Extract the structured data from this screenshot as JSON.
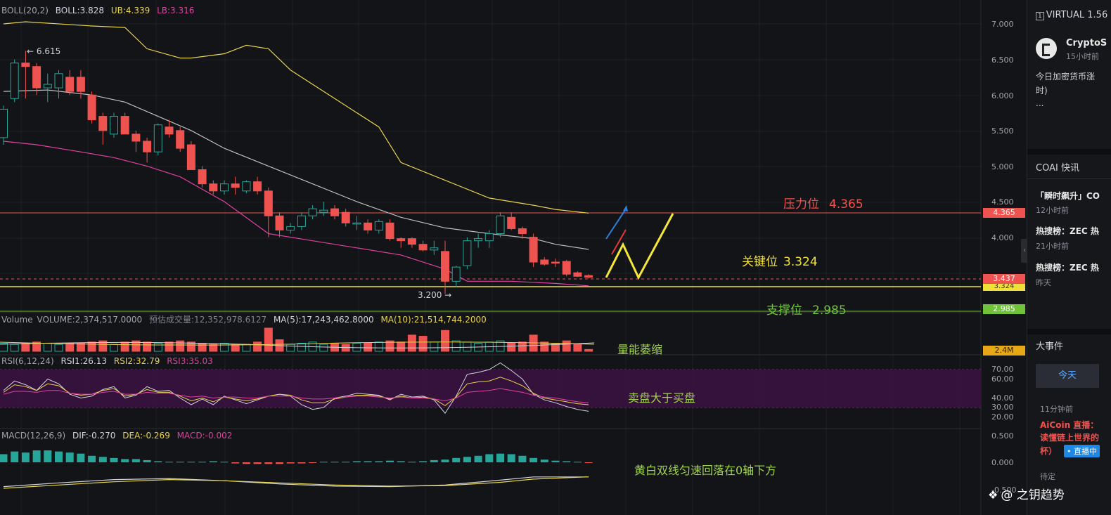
{
  "indicators": {
    "boll": {
      "name": "BOLL(20,2)",
      "value": "BOLL:3.828",
      "ub": "UB:4.339",
      "lb": "LB:3.316"
    },
    "volume": {
      "name": "Volume",
      "value": "VOLUME:2,374,517.0000",
      "estimate": "预估成交量:12,352,978.6127",
      "ma5": "MA(5):17,243,462.8000",
      "ma10": "MA(10):21,514,744.2000"
    },
    "rsi": {
      "name": "RSI(6,12,24)",
      "rsi1": "RSI1:26.13",
      "rsi2": "RSI2:32.79",
      "rsi3": "RSI3:35.03"
    },
    "macd": {
      "name": "MACD(12,26,9)",
      "dif": "DIF:-0.270",
      "dea": "DEA:-0.269",
      "macd": "MACD:-0.002"
    }
  },
  "price_axis": [
    "7.000",
    "6.500",
    "6.000",
    "5.500",
    "5.000",
    "4.500",
    "4.000"
  ],
  "rsi_axis": [
    "70.00",
    "60.00",
    "40.00",
    "30.00",
    "20.00"
  ],
  "macd_axis": [
    "0.500",
    "0.000",
    "-0.500"
  ],
  "price_tags": {
    "resistance": "4.365",
    "current": "3.437",
    "key": "3.324",
    "support": "2.985",
    "volume": "2.4M"
  },
  "chart_labels": {
    "high": "← 6.615",
    "low": "3.200 →"
  },
  "annotations": {
    "resistance_label": "压力位",
    "resistance_value": "4.365",
    "key_label": "关键位",
    "key_value": "3.324",
    "support_label": "支撑位",
    "support_value": "2.985",
    "volume_note": "量能萎缩",
    "rsi_note": "卖盘大于买盘",
    "macd_note": "黄白双线匀速回落在0轴下方"
  },
  "colors": {
    "up": "#26a69a",
    "down": "#ef5350",
    "upper_band": "#e8d44d",
    "lower_band": "#e040a0",
    "mid_band": "#bfbfbf",
    "resistance": "#ef5350",
    "key": "#f0e03a",
    "support": "#6fc23a"
  },
  "chart_data": {
    "type": "candlestick",
    "ylim": [
      2.9,
      7.1
    ],
    "candles": [
      {
        "o": 5.4,
        "h": 5.85,
        "l": 5.3,
        "c": 5.8
      },
      {
        "o": 5.95,
        "h": 6.5,
        "l": 5.9,
        "c": 6.45
      },
      {
        "o": 6.45,
        "h": 6.62,
        "l": 5.95,
        "c": 6.4
      },
      {
        "o": 6.4,
        "h": 6.45,
        "l": 6.0,
        "c": 6.1
      },
      {
        "o": 6.1,
        "h": 6.3,
        "l": 5.9,
        "c": 6.15
      },
      {
        "o": 6.1,
        "h": 6.35,
        "l": 5.95,
        "c": 6.3
      },
      {
        "o": 6.25,
        "h": 6.35,
        "l": 6.0,
        "c": 6.05
      },
      {
        "o": 6.25,
        "h": 6.35,
        "l": 5.95,
        "c": 6.05
      },
      {
        "o": 6.0,
        "h": 6.05,
        "l": 5.6,
        "c": 5.65
      },
      {
        "o": 5.7,
        "h": 5.75,
        "l": 5.3,
        "c": 5.5
      },
      {
        "o": 5.45,
        "h": 5.75,
        "l": 5.4,
        "c": 5.7
      },
      {
        "o": 5.7,
        "h": 5.75,
        "l": 5.45,
        "c": 5.45
      },
      {
        "o": 5.45,
        "h": 5.5,
        "l": 5.2,
        "c": 5.35
      },
      {
        "o": 5.35,
        "h": 5.4,
        "l": 5.05,
        "c": 5.2
      },
      {
        "o": 5.2,
        "h": 5.6,
        "l": 5.15,
        "c": 5.58
      },
      {
        "o": 5.55,
        "h": 5.65,
        "l": 5.4,
        "c": 5.45
      },
      {
        "o": 5.5,
        "h": 5.55,
        "l": 5.2,
        "c": 5.25
      },
      {
        "o": 5.3,
        "h": 5.35,
        "l": 4.95,
        "c": 4.95
      },
      {
        "o": 4.95,
        "h": 5.0,
        "l": 4.7,
        "c": 4.75
      },
      {
        "o": 4.75,
        "h": 4.8,
        "l": 4.6,
        "c": 4.65
      },
      {
        "o": 4.65,
        "h": 4.8,
        "l": 4.6,
        "c": 4.75
      },
      {
        "o": 4.75,
        "h": 4.85,
        "l": 4.6,
        "c": 4.7
      },
      {
        "o": 4.65,
        "h": 4.8,
        "l": 4.62,
        "c": 4.78
      },
      {
        "o": 4.78,
        "h": 4.85,
        "l": 4.6,
        "c": 4.65
      },
      {
        "o": 4.65,
        "h": 4.7,
        "l": 4.0,
        "c": 4.3
      },
      {
        "o": 4.3,
        "h": 4.35,
        "l": 4.0,
        "c": 4.1
      },
      {
        "o": 4.1,
        "h": 4.2,
        "l": 4.05,
        "c": 4.15
      },
      {
        "o": 4.15,
        "h": 4.35,
        "l": 4.1,
        "c": 4.3
      },
      {
        "o": 4.3,
        "h": 4.45,
        "l": 4.25,
        "c": 4.4
      },
      {
        "o": 4.35,
        "h": 4.5,
        "l": 4.3,
        "c": 4.38
      },
      {
        "o": 4.4,
        "h": 4.45,
        "l": 4.25,
        "c": 4.3
      },
      {
        "o": 4.35,
        "h": 4.4,
        "l": 4.15,
        "c": 4.2
      },
      {
        "o": 4.2,
        "h": 4.3,
        "l": 4.1,
        "c": 4.2
      },
      {
        "o": 4.2,
        "h": 4.25,
        "l": 4.05,
        "c": 4.1
      },
      {
        "o": 4.1,
        "h": 4.25,
        "l": 4.05,
        "c": 4.22
      },
      {
        "o": 4.2,
        "h": 4.25,
        "l": 3.95,
        "c": 3.98
      },
      {
        "o": 3.98,
        "h": 4.0,
        "l": 3.85,
        "c": 3.95
      },
      {
        "o": 3.98,
        "h": 4.0,
        "l": 3.85,
        "c": 3.9
      },
      {
        "o": 3.9,
        "h": 3.95,
        "l": 3.8,
        "c": 3.82
      },
      {
        "o": 3.82,
        "h": 3.95,
        "l": 3.75,
        "c": 3.85
      },
      {
        "o": 3.8,
        "h": 3.95,
        "l": 3.2,
        "c": 3.38
      },
      {
        "o": 3.38,
        "h": 3.6,
        "l": 3.3,
        "c": 3.58
      },
      {
        "o": 3.6,
        "h": 4.0,
        "l": 3.55,
        "c": 3.95
      },
      {
        "o": 3.95,
        "h": 4.05,
        "l": 3.85,
        "c": 3.98
      },
      {
        "o": 3.95,
        "h": 4.1,
        "l": 3.85,
        "c": 4.05
      },
      {
        "o": 4.05,
        "h": 4.35,
        "l": 4.0,
        "c": 4.3
      },
      {
        "o": 4.28,
        "h": 4.35,
        "l": 4.1,
        "c": 4.12
      },
      {
        "o": 4.12,
        "h": 4.15,
        "l": 3.98,
        "c": 4.05
      },
      {
        "o": 4.0,
        "h": 4.05,
        "l": 3.58,
        "c": 3.65
      },
      {
        "o": 3.68,
        "h": 3.72,
        "l": 3.6,
        "c": 3.62
      },
      {
        "o": 3.65,
        "h": 3.7,
        "l": 3.58,
        "c": 3.64
      },
      {
        "o": 3.66,
        "h": 3.68,
        "l": 3.45,
        "c": 3.48
      },
      {
        "o": 3.5,
        "h": 3.52,
        "l": 3.44,
        "c": 3.45
      },
      {
        "o": 3.46,
        "h": 3.48,
        "l": 3.42,
        "c": 3.437
      }
    ],
    "boll_upper": [
      [
        0,
        7.0
      ],
      [
        2,
        7.03
      ],
      [
        8,
        6.97
      ],
      [
        11,
        6.95
      ],
      [
        13,
        6.65
      ],
      [
        16,
        6.52
      ],
      [
        17,
        6.52
      ],
      [
        20,
        6.58
      ],
      [
        22,
        6.7
      ],
      [
        24,
        6.65
      ],
      [
        26,
        6.35
      ],
      [
        30,
        5.95
      ],
      [
        34,
        5.55
      ],
      [
        36,
        5.05
      ],
      [
        40,
        4.8
      ],
      [
        44,
        4.55
      ],
      [
        48,
        4.45
      ],
      [
        50,
        4.39
      ],
      [
        53,
        4.339
      ]
    ],
    "boll_mid": [
      [
        0,
        6.05
      ],
      [
        4,
        6.07
      ],
      [
        8,
        6.0
      ],
      [
        11,
        5.9
      ],
      [
        14,
        5.7
      ],
      [
        17,
        5.5
      ],
      [
        20,
        5.25
      ],
      [
        24,
        5.0
      ],
      [
        28,
        4.75
      ],
      [
        32,
        4.5
      ],
      [
        36,
        4.28
      ],
      [
        40,
        4.13
      ],
      [
        44,
        4.05
      ],
      [
        48,
        3.98
      ],
      [
        50,
        3.9
      ],
      [
        53,
        3.828
      ]
    ],
    "boll_lower": [
      [
        0,
        5.35
      ],
      [
        3,
        5.3
      ],
      [
        7,
        5.2
      ],
      [
        10,
        5.12
      ],
      [
        13,
        5.0
      ],
      [
        16,
        4.85
      ],
      [
        20,
        4.5
      ],
      [
        24,
        4.05
      ],
      [
        28,
        3.95
      ],
      [
        32,
        3.85
      ],
      [
        36,
        3.75
      ],
      [
        40,
        3.55
      ],
      [
        42,
        3.38
      ],
      [
        46,
        3.38
      ],
      [
        50,
        3.35
      ],
      [
        53,
        3.316
      ]
    ],
    "volume": [
      0.35,
      0.3,
      0.35,
      0.4,
      0.35,
      0.3,
      0.35,
      0.35,
      0.4,
      0.45,
      0.3,
      0.4,
      0.45,
      0.4,
      0.35,
      0.4,
      0.45,
      0.4,
      0.35,
      0.3,
      0.35,
      0.3,
      0.3,
      0.4,
      1.0,
      0.5,
      0.3,
      0.35,
      0.4,
      0.3,
      0.35,
      0.3,
      0.35,
      0.35,
      0.4,
      0.45,
      0.4,
      0.7,
      0.65,
      0.4,
      0.9,
      0.45,
      0.4,
      0.35,
      0.4,
      0.45,
      0.35,
      0.4,
      0.7,
      0.4,
      0.35,
      0.45,
      0.3,
      0.08
    ],
    "rsi1": [
      48,
      58,
      54,
      48,
      60,
      55,
      44,
      40,
      42,
      49,
      52,
      40,
      43,
      52,
      47,
      48,
      40,
      33,
      39,
      33,
      42,
      38,
      34,
      38,
      42,
      44,
      42,
      33,
      28,
      30,
      40,
      42,
      45,
      44,
      43,
      38,
      44,
      41,
      42,
      38,
      24,
      42,
      65,
      67,
      70,
      77,
      69,
      60,
      44,
      38,
      35,
      31,
      28,
      26
    ],
    "rsi2": [
      46,
      54,
      52,
      48,
      55,
      53,
      45,
      43,
      44,
      48,
      50,
      42,
      44,
      49,
      46,
      46,
      42,
      37,
      40,
      36,
      41,
      39,
      37,
      39,
      42,
      44,
      43,
      38,
      35,
      35,
      39,
      41,
      43,
      43,
      42,
      39,
      42,
      40,
      41,
      39,
      32,
      41,
      55,
      57,
      58,
      62,
      58,
      53,
      45,
      40,
      38,
      36,
      34,
      33
    ],
    "rsi3": [
      44,
      47,
      47,
      46,
      48,
      48,
      45,
      44,
      44,
      46,
      47,
      44,
      44,
      46,
      45,
      45,
      43,
      41,
      42,
      40,
      41,
      41,
      40,
      40,
      42,
      42,
      42,
      40,
      39,
      39,
      40,
      41,
      42,
      42,
      41,
      40,
      41,
      40,
      40,
      39,
      37,
      40,
      46,
      47,
      48,
      50,
      48,
      46,
      43,
      41,
      40,
      38,
      36,
      35
    ],
    "macd_hist": [
      0.15,
      0.2,
      0.18,
      0.22,
      0.22,
      0.2,
      0.18,
      0.16,
      0.12,
      0.1,
      0.08,
      0.06,
      0.06,
      0.04,
      0.02,
      0.01,
      0.01,
      0.01,
      0.01,
      0.02,
      0.01,
      -0.02,
      -0.03,
      -0.03,
      -0.03,
      -0.03,
      -0.02,
      -0.02,
      -0.01,
      0.01,
      0.01,
      0.01,
      0.02,
      0.02,
      0.02,
      0.03,
      0.02,
      0.01,
      0.02,
      0.04,
      0.05,
      0.08,
      0.1,
      0.12,
      0.15,
      0.16,
      0.15,
      0.12,
      0.08,
      0.05,
      0.03,
      0.02,
      0.01,
      -0.002
    ],
    "macd_dif": [
      [
        0,
        -0.45
      ],
      [
        5,
        -0.38
      ],
      [
        10,
        -0.32
      ],
      [
        15,
        -0.3
      ],
      [
        20,
        -0.34
      ],
      [
        25,
        -0.4
      ],
      [
        30,
        -0.44
      ],
      [
        35,
        -0.45
      ],
      [
        40,
        -0.42
      ],
      [
        45,
        -0.33
      ],
      [
        48,
        -0.27
      ],
      [
        53,
        -0.27
      ]
    ],
    "macd_dea": [
      [
        0,
        -0.48
      ],
      [
        5,
        -0.42
      ],
      [
        10,
        -0.36
      ],
      [
        15,
        -0.32
      ],
      [
        20,
        -0.34
      ],
      [
        25,
        -0.38
      ],
      [
        30,
        -0.42
      ],
      [
        35,
        -0.44
      ],
      [
        40,
        -0.43
      ],
      [
        45,
        -0.37
      ],
      [
        48,
        -0.31
      ],
      [
        53,
        -0.269
      ]
    ]
  },
  "sidebar": {
    "symbol": "VIRTUAL 1.56",
    "source_name": "CryptoS",
    "source_time": "15小时前",
    "news_line1": "今日加密货币涨",
    "news_line2": "时)",
    "news_more": "...",
    "section_flash": "COAI 快讯",
    "flash1_title": "「瞬时飙升」CO",
    "flash1_time": "12小时前",
    "flash2_title": "热搜榜：ZEC 热",
    "flash2_time": "21小时前",
    "flash3_title": "热搜榜：ZEC 热",
    "flash3_time": "昨天",
    "section_events": "大事件",
    "today_button": "今天",
    "event_time": "11分钟前",
    "event_title1": "AiCoin 直播：",
    "event_title2": "读懂链上世界的",
    "event_title3": "杯）",
    "live_badge": "• 直播中",
    "pending": "待定"
  },
  "watermark": "@ 之钥趋势"
}
